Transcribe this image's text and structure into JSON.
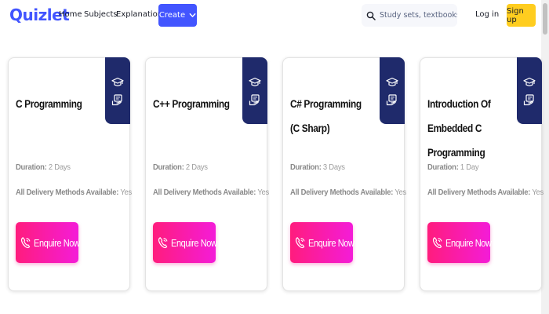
{
  "header": {
    "logo": "Quizlet",
    "nav": [
      "Home",
      "Subjects",
      "Explanations"
    ],
    "create_label": "Create",
    "search_placeholder": "Study sets, textbooks, ...",
    "login_label": "Log in",
    "signup_label": "Sign up"
  },
  "colors": {
    "brand": "#4255ff",
    "signup": "#ffcd1f",
    "badge": "#1f2a6b",
    "enquire_start": "#ff1c7d",
    "enquire_end": "#f41cd8"
  },
  "labels": {
    "duration": "Duration:",
    "delivery": "All Delivery Methods Available:",
    "enquire": "Enquire Now"
  },
  "icons": {
    "badge_top": "graduation-cap-icon",
    "badge_bottom": "certificate-hand-icon",
    "enquire": "phone-icon",
    "search": "search-icon",
    "create": "chevron-down-icon"
  },
  "courses": [
    {
      "title": "C Programming",
      "duration": "2 Days",
      "delivery": "Yes"
    },
    {
      "title": "C++ Programming",
      "duration": "2 Days",
      "delivery": "Yes"
    },
    {
      "title": "C# Programming (C Sharp)",
      "duration": "3 Days",
      "delivery": "Yes"
    },
    {
      "title": "Introduction Of Embedded C Programming",
      "duration": "1 Day",
      "delivery": "Yes"
    }
  ]
}
